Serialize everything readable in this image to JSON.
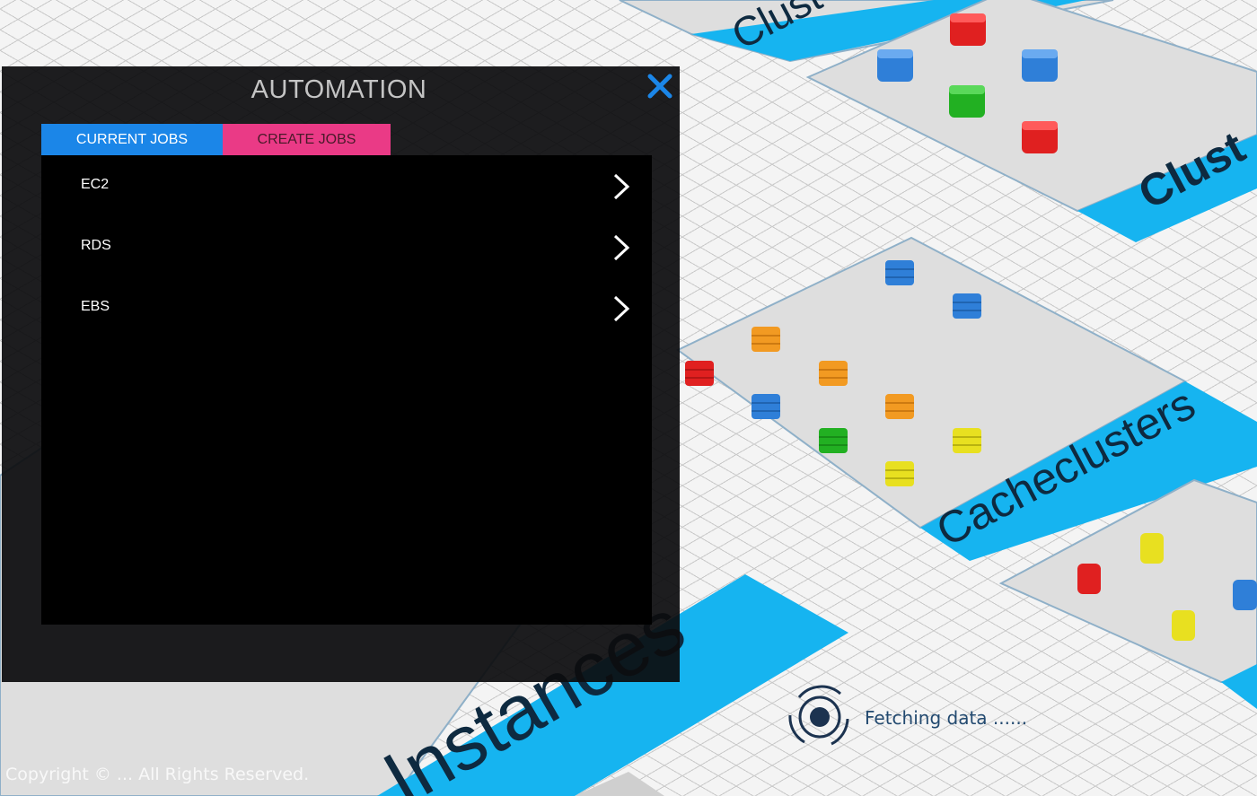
{
  "automation": {
    "title": "AUTOMATION",
    "tabs": {
      "current": "CURRENT JOBS",
      "create": "CREATE JOBS"
    },
    "jobs": [
      {
        "label": "EC2"
      },
      {
        "label": "RDS"
      },
      {
        "label": "EBS"
      }
    ],
    "icons": {
      "close": "close-icon",
      "row": "chevron-right-icon"
    }
  },
  "scene": {
    "labels": {
      "clusters_top": "Clust",
      "clusters_right": "Clust",
      "cacheclusters": "Cacheclusters",
      "instances": "Instances"
    }
  },
  "status": {
    "loading_text": "Fetching data ......"
  },
  "footer": {
    "copyright": "Copyright © ... All Rights Reserved."
  },
  "colors": {
    "accent_blue": "#1b86e8",
    "accent_pink": "#ea3a86",
    "platform_label": "#16b4f0",
    "node_red": "#e02020",
    "node_blue": "#2f7fd8",
    "node_green": "#22b022",
    "node_orange": "#f29a22",
    "node_yellow": "#e8e020"
  }
}
